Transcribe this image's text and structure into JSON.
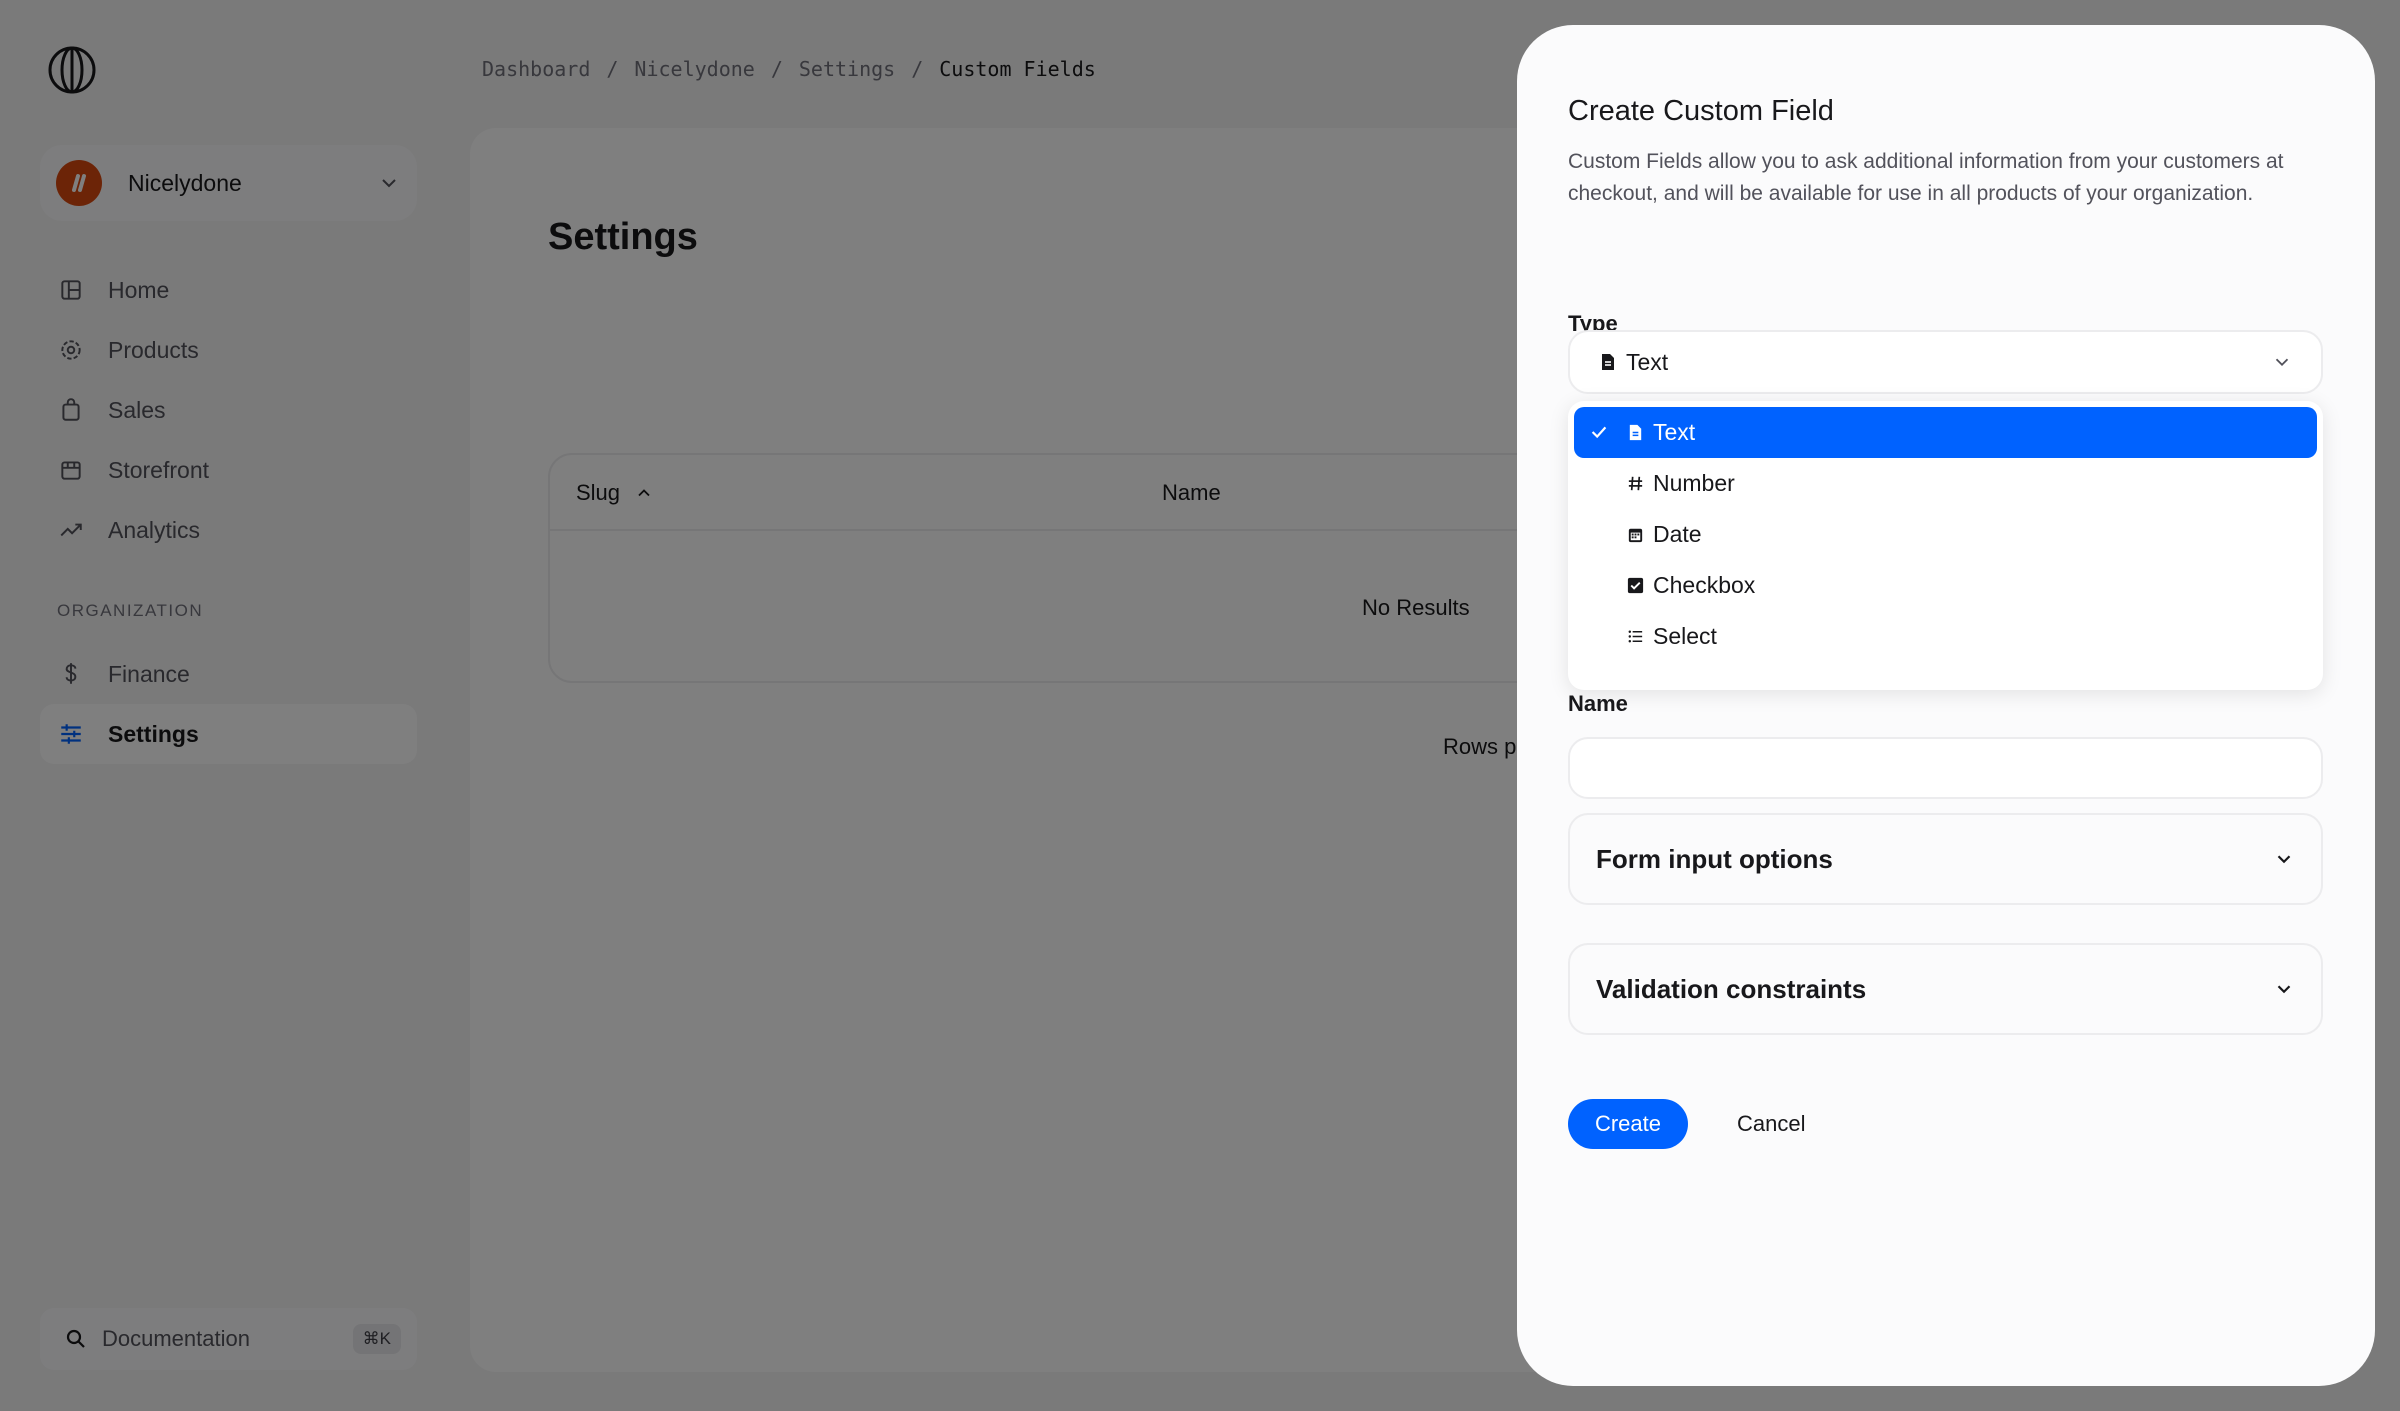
{
  "org": {
    "name": "Nicelydone"
  },
  "nav": {
    "items": [
      {
        "label": "Home",
        "icon": "home-icon"
      },
      {
        "label": "Products",
        "icon": "products-icon"
      },
      {
        "label": "Sales",
        "icon": "sales-icon"
      },
      {
        "label": "Storefront",
        "icon": "storefront-icon"
      },
      {
        "label": "Analytics",
        "icon": "analytics-icon"
      }
    ],
    "section_label": "ORGANIZATION",
    "org_items": [
      {
        "label": "Finance",
        "icon": "dollar-icon"
      },
      {
        "label": "Settings",
        "icon": "settings-sliders-icon",
        "active": true
      }
    ]
  },
  "documentation": {
    "label": "Documentation",
    "shortcut": "⌘K"
  },
  "breadcrumb": [
    "Dashboard",
    "Nicelydone",
    "Settings",
    "Custom Fields"
  ],
  "breadcrumb_separator": "/",
  "page": {
    "title": "Settings",
    "table": {
      "columns": [
        "Slug",
        "Name"
      ],
      "empty_text": "No Results"
    },
    "rows_per_page_partial": "Rows p"
  },
  "modal": {
    "title": "Create Custom Field",
    "description": "Custom Fields allow you to ask additional information from your customers at checkout, and will be available for use in all products of your organization.",
    "type_label": "Type",
    "type_value": "Text",
    "type_options": [
      {
        "label": "Text",
        "icon": "document-icon",
        "selected": true
      },
      {
        "label": "Number",
        "icon": "hash-icon"
      },
      {
        "label": "Date",
        "icon": "calendar-icon"
      },
      {
        "label": "Checkbox",
        "icon": "checkbox-icon"
      },
      {
        "label": "Select",
        "icon": "list-icon"
      }
    ],
    "name_label": "Name",
    "name_value": "",
    "sections": [
      "Form input options",
      "Validation constraints"
    ],
    "create_label": "Create",
    "cancel_label": "Cancel"
  },
  "colors": {
    "accent": "#0062ff",
    "org_avatar": "#d9480f",
    "overlay": "rgba(0,0,0,0.5)"
  }
}
